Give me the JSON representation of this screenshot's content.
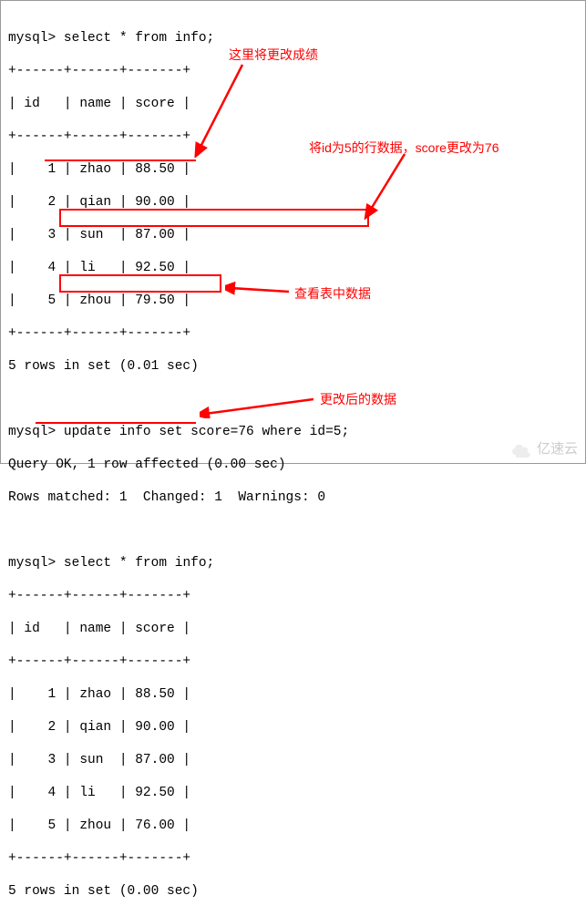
{
  "prompt": "mysql>",
  "queries": {
    "select1": "select * from info;",
    "update": "update info set score=76 where id=5;",
    "select2": "select * from info;"
  },
  "table1": {
    "sep": "+------+------+-------+",
    "header": "| id   | name | score |",
    "rows": [
      "|    1 | zhao | 88.50 |",
      "|    2 | qian | 90.00 |",
      "|    3 | sun  | 87.00 |",
      "|    4 | li   | 92.50 |",
      "|    5 | zhou | 79.50 |"
    ],
    "footer": "5 rows in set (0.01 sec)"
  },
  "update_result": {
    "line1": "Query OK, 1 row affected (0.00 sec)",
    "line2": "Rows matched: 1  Changed: 1  Warnings: 0"
  },
  "table2": {
    "sep": "+------+------+-------+",
    "header": "| id   | name | score |",
    "rows": [
      "|    1 | zhao | 88.50 |",
      "|    2 | qian | 90.00 |",
      "|    3 | sun  | 87.00 |",
      "|    4 | li   | 92.50 |",
      "|    5 | zhou | 76.00 |"
    ],
    "footer": "5 rows in set (0.00 sec)"
  },
  "annotations": {
    "a1": "这里将更改成绩",
    "a2": "将id为5的行数据，score更改为76",
    "a3": "查看表中数据",
    "a4": "更改后的数据"
  },
  "watermark": "亿速云",
  "chart_data": {
    "type": "table",
    "tables": [
      {
        "title": "info (before update)",
        "columns": [
          "id",
          "name",
          "score"
        ],
        "rows": [
          [
            1,
            "zhao",
            88.5
          ],
          [
            2,
            "qian",
            90.0
          ],
          [
            3,
            "sun",
            87.0
          ],
          [
            4,
            "li",
            92.5
          ],
          [
            5,
            "zhou",
            79.5
          ]
        ]
      },
      {
        "title": "info (after update)",
        "columns": [
          "id",
          "name",
          "score"
        ],
        "rows": [
          [
            1,
            "zhao",
            88.5
          ],
          [
            2,
            "qian",
            90.0
          ],
          [
            3,
            "sun",
            87.0
          ],
          [
            4,
            "li",
            92.5
          ],
          [
            5,
            "zhou",
            76.0
          ]
        ]
      }
    ]
  }
}
